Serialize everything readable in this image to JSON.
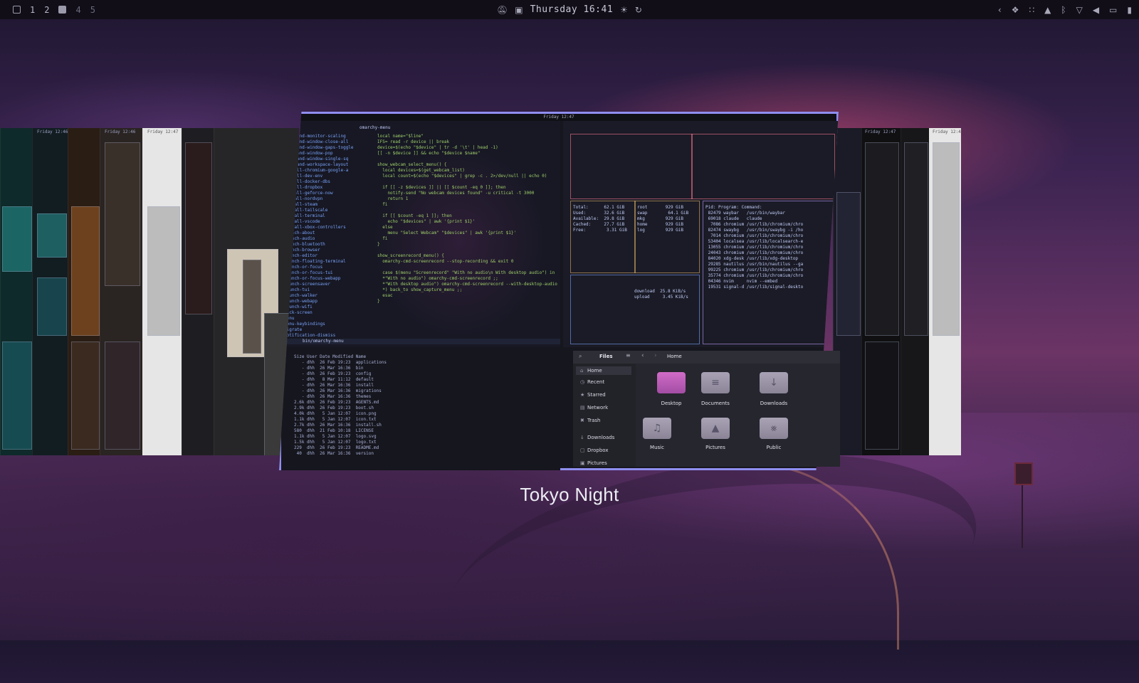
{
  "topbar": {
    "workspaces": [
      "1",
      "2",
      "4",
      "5"
    ],
    "clock": "Thursday 16:41",
    "icons_left": [
      "layout-icon",
      "workspace-square-icon"
    ],
    "icons_center": [
      "mute-icon",
      "screen-record-icon",
      "brightness-icon",
      "refresh-icon"
    ],
    "icons_right": [
      "chevron-left-icon",
      "dropbox-icon",
      "grid-icon",
      "cat-icon",
      "bluetooth-icon",
      "wifi-icon",
      "volume-icon",
      "display-icon",
      "battery-icon"
    ]
  },
  "preview": {
    "frame_clock": "Friday 12:47",
    "side_clocks": [
      "Friday 12:46",
      "Friday 12:46",
      "Friday 12:47",
      "Friday 12:47",
      "Friday 12:48"
    ],
    "terminal_tab": "omarchy-menu",
    "terminal_path": "bin/omarchy-menu",
    "terminal_code": "local name=\"$line\"\nIFS= read -r device || break\ndevice=$(echo \"$device\" | tr -d '\\t' | head -1)\n[[ -n $device ]] && echo \"$device $name\"\n\nshow_webcam_select_menu() {\n  local devices=$(get_webcam_list)\n  local count=$(echo \"$devices\" | grep -c . 2>/dev/null || echo 0)\n\n  if [[ -z $devices ]] || [[ $count -eq 0 ]]; then\n    notify-send \"No webcam devices found\" -u critical -t 3000\n    return 1\n  fi\n\n  if [[ $count -eq 1 ]]; then\n    echo \"$devices\" | awk '{print $1}'\n  else\n    menu \"Select Webcam\" \"$devices\" | awk '{print $1}'\n  fi\n}\n\nshow_screenrecord_menu() {\n  omarchy-cmd-screenrecord --stop-recording && exit 0\n\n  case $(menu \"Screenrecord\" \"With no audio\\n With desktop audio\") in\n  *\"With no audio\") omarchy-cmd-screenrecord ;;\n  *\"With desktop audio\") omarchy-cmd-screenrecord --with-desktop-audio ;;\n  *) back_to show_capture_menu ;;\n  esac\n}",
    "terminal_files": "hyprland-monitor-scaling\nhyprland-window-close-all\nhyprland-window-gaps-toggle\nhyprland-window-pop\nhyprland-window-single-sq\nhyprland-workspace-layout\ninstall-chromium-google-a\ninstall-dev-env\ninstall-docker-dbs\ninstall-dropbox\ninstall-geforce-now\ninstall-nordvpn\ninstall-steam\ninstall-tailscale\ninstall-terminal\ninstall-vscode\ninstall-xbox-controllers\nlaunch-about\nlaunch-audio\nlaunch-bluetooth\nlaunch-browser\nlaunch-editor\nlaunch-floating-terminal\nlaunch-or-focus\nlaunch-or-focus-tui\nlaunch-or-focus-webapp\nlaunch-screensaver\nlaunch-tui\nlaunch-walker\nlaunch-webapp\nlaunch-wifi\nlock-screen\nmenu\nmenu-keybindings\nmigrate\nnotification-dismiss\nnpx-install",
    "ls_output": "Size User Date Modified Name\n   - dhh  26 Feb 19:23  applications\n   - dhh  26 Mar 16:36  bin\n   - dhh  26 Feb 19:23  config\n   - dhh   8 Mar 11:12  default\n   - dhh  26 Mar 16:36  install\n   - dhh  26 Mar 16:36  migrations\n   - dhh  26 Mar 16:36  themes\n2.6k dhh  26 Feb 19:23  AGENTS.md\n2.9k dhh  26 Feb 19:23  boot.sh\n4.0k dhh   5 Jan 12:07  icon.png\n1.1k dhh   5 Jan 12:07  icon.txt\n2.7k dhh  26 Mar 16:36  install.sh\n580  dhh  21 Feb 10:18  LICENSE\n1.1k dhh   5 Jan 12:07  logo.svg\n1.5k dhh   5 Jan 12:07  logo.txt\n229  dhh  26 Feb 19:23  README.md\n 40  dhh  26 Mar 16:36  version",
    "btop_procs": "Pid: Program: Command:\n 82479 waybar   /usr/bin/waybar\n 69018 claude   claude\n  7086 chromium /usr/lib/chromium/chro\n 82474 swaybg   /usr/bin/swaybg -i /ho\n  7014 chromium /usr/lib/chromium/chro\n 53404 localsea /usr/lib/localsearch-e\n 13055 chromium /usr/lib/chromium/chro\n 24043 chromium /usr/lib/chromium/chro\n 84020 xdg-desk /usr/lib/xdg-desktop\n 29285 nautilus /usr/bin/nautilus --ga\n 99225 chromium /usr/lib/chromium/chro\n 35774 chromium /usr/lib/chromium/chro\n 04346 nvim     nvim --embed\n 19531 signal-d /usr/lib/signal-deskto",
    "btop_mem": "Total:      62.1 GiB\nUsed:       32.6 GiB\nAvailable:  29.8 GiB\nCached:     27.7 GiB\nFree:        3.31 GiB",
    "btop_disks": "root       929 GiB\nswap        64.1 GiB\nmkg        929 GiB\nhome       929 GiB\nlog        929 GiB",
    "btop_net": "download  25.8 KiB/s\nupload     3.45 KiB/s",
    "files": {
      "title": "Files",
      "location": "Home",
      "sidebar": [
        "Home",
        "Recent",
        "Starred",
        "Network",
        "Trash",
        "Downloads",
        "Dropbox",
        "Pictures"
      ],
      "folders": [
        "Desktop",
        "Documents",
        "Downloads",
        "Music",
        "Pictures",
        "Public"
      ]
    }
  },
  "theme_name": "Tokyo Night",
  "colors": {
    "accent": "#8f8ef0",
    "background": "#1a1b26",
    "folder": "#a9a3b5",
    "folder_desktop": "#c35fbd"
  }
}
